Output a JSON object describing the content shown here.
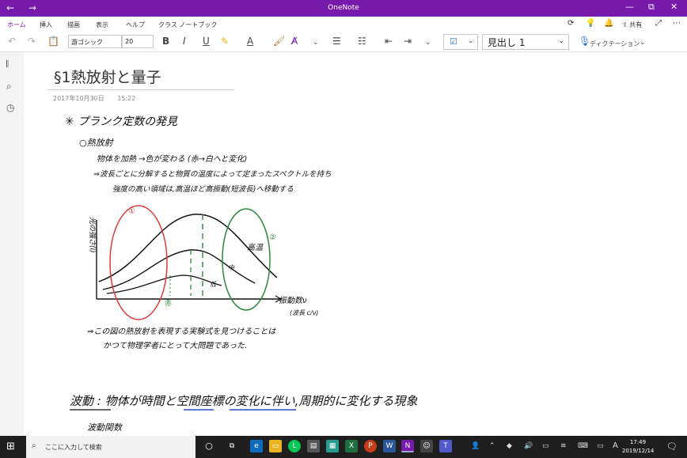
{
  "window": {
    "title": "OneNote",
    "back": "←",
    "forward": "→",
    "controls": [
      "—",
      "⧉",
      "✕"
    ]
  },
  "menu": {
    "tabs": [
      "ホーム",
      "挿入",
      "描画",
      "表示",
      "ヘルプ",
      "クラス ノートブック"
    ],
    "share_label": "共有"
  },
  "ribbon": {
    "font_name": "游ゴシック",
    "font_size": "20",
    "bold": "B",
    "italic": "I",
    "underline": "U",
    "font_color": "A",
    "style_value": "見出し 1",
    "dictation_label": "ディクテーション"
  },
  "page": {
    "title": "§1熱放射と量子",
    "date": "2017年10月30日",
    "time": "15:22"
  },
  "handwriting": {
    "heading": "✳ プランク定数の発見",
    "sub1": "○熱放射",
    "line1": "物体を加熱 →色が変わる (赤→白へと変化)",
    "line2": "⇒波長ごとに分解すると物質の温度によって定まったスペクトルを持ち",
    "line3": "強度の高い領域は,高温ほど高振動(短波長)へ移動する",
    "ylabel": "光の強さ(I)",
    "circle1": "①",
    "circle2": "②",
    "high": "高温",
    "mid": "中",
    "low": "低",
    "red": "赤",
    "green": "緑",
    "xlabel": "振動数ν",
    "xsub": "(波長 c/ν)",
    "concl1": "⇒この図の熱放射を表現する実験式を見つけることは",
    "concl2": "かつて物理学者にとって大問題であった.",
    "wave_def": "波動 : 物体が時間と空間座標の変化に伴い,周期的に変化する現象",
    "wave_sub": "波動関数"
  },
  "taskbar": {
    "search_placeholder": "ここに入力して検索",
    "time": "17:49",
    "date": "2019/12/14",
    "ime": "A"
  }
}
